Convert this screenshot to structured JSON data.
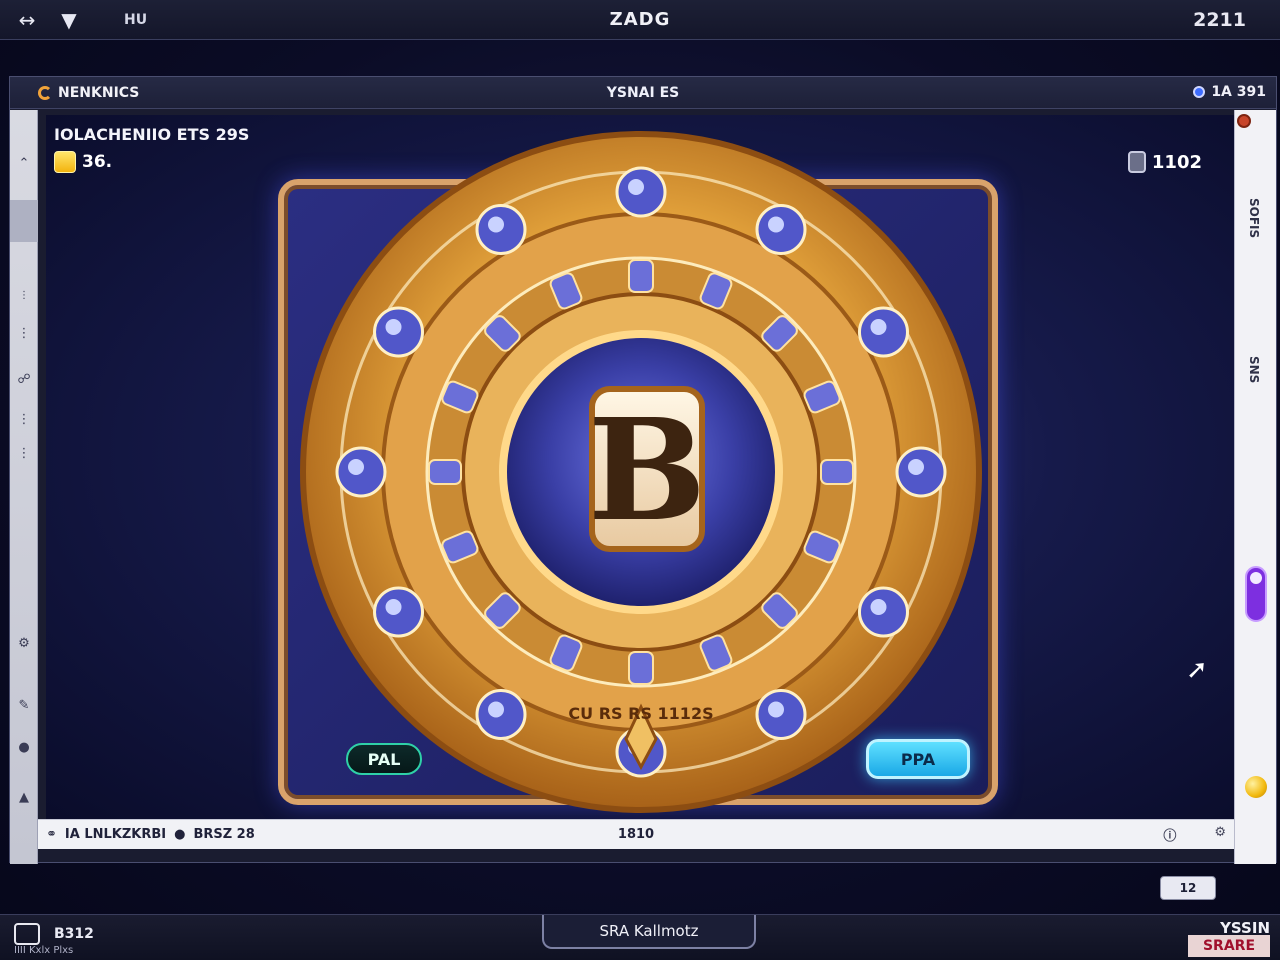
{
  "topbar": {
    "menu": "HU",
    "title": "ZADG",
    "clock": "2211"
  },
  "window": {
    "app_name": "NENKNICS",
    "title": "YSNAI ES",
    "right_status": "1A 391"
  },
  "hud": {
    "title": "IOLACHENIIO ETS 29S",
    "balance": "36.",
    "bet": "1102"
  },
  "wheel": {
    "center_letter": "B",
    "bottom_label": "CU RS RS 1112S"
  },
  "buttons": {
    "left": "PAL",
    "right": "PPA"
  },
  "status_bar": {
    "left": "IA LNLKZKRBI",
    "left_extra": "BRSZ 28",
    "center": "1810"
  },
  "right_sidebar": {
    "text_1": "SOFIS",
    "text_2": "SNS"
  },
  "dock": {
    "mini_label": "12"
  },
  "bottombar": {
    "left_label": "B312",
    "sub_label": "IIII Kxlx Plxs",
    "center": "SRA Kallmotz",
    "right": "YSSIN",
    "logo": "SRARE"
  },
  "colors": {
    "gold": "#e9a93f",
    "gold_light": "#ffd98a",
    "purple": "#2b2f78",
    "accent_cyan": "#1aa8e6",
    "toggle_purple": "#7d2fe0"
  }
}
